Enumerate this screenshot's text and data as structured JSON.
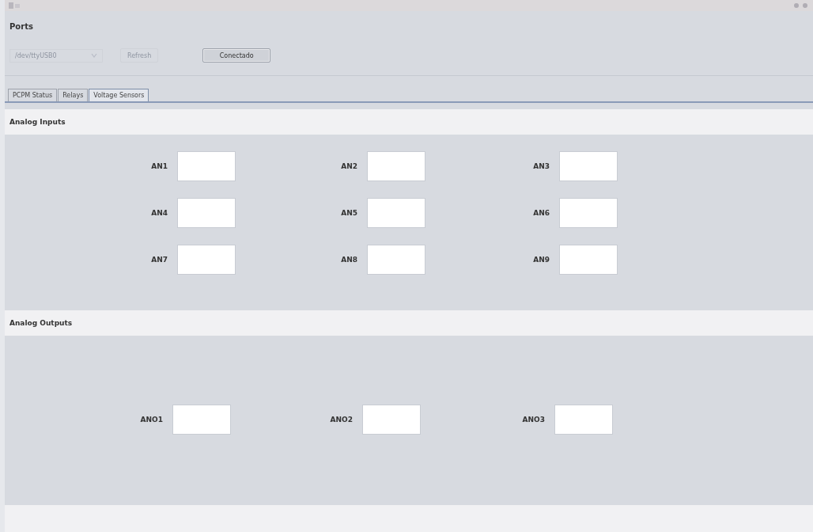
{
  "ports": {
    "title": "Ports",
    "port_select": {
      "value": "/dev/ttyUSB0",
      "disabled": true
    },
    "refresh_button": {
      "label": "Refresh",
      "disabled": true
    },
    "connect_button": {
      "label": "Conectado",
      "disabled": false
    }
  },
  "tabs": [
    {
      "label": "PCPM Status",
      "selected": false
    },
    {
      "label": "Relays",
      "selected": false
    },
    {
      "label": "Voltage Sensors",
      "selected": true
    }
  ],
  "sections": [
    {
      "title": "Analog Inputs",
      "kind": "inputs",
      "fields": [
        {
          "label": "AN1"
        },
        {
          "label": "AN2"
        },
        {
          "label": "AN3"
        },
        {
          "label": "AN4"
        },
        {
          "label": "AN5"
        },
        {
          "label": "AN6"
        },
        {
          "label": "AN7"
        },
        {
          "label": "AN8"
        },
        {
          "label": "AN9"
        }
      ]
    },
    {
      "title": "Analog Outputs",
      "kind": "outputs",
      "fields": [
        {
          "label": "ANO1"
        },
        {
          "label": "ANO2"
        },
        {
          "label": "ANO3"
        }
      ]
    }
  ]
}
